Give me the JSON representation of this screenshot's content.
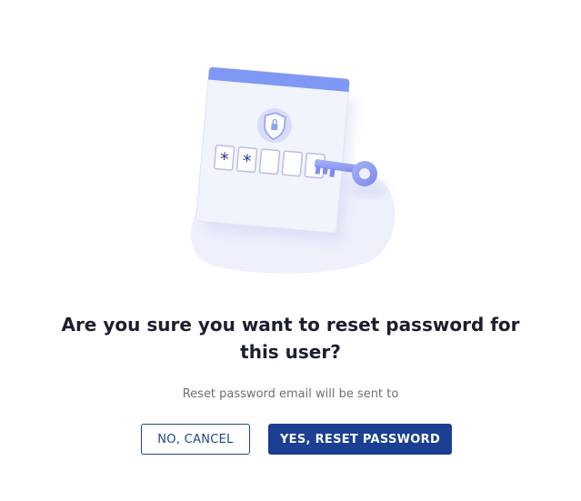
{
  "dialog": {
    "title": "Are you sure you want to reset password for this user?",
    "message": "Reset password email will be sent to",
    "cancel_label": "NO, CANCEL",
    "confirm_label": "YES, RESET PASSWORD"
  },
  "illustration": {
    "icons": [
      "shield-lock-icon",
      "key-icon"
    ],
    "password_slots": [
      "*",
      "*",
      "",
      "",
      ""
    ]
  },
  "colors": {
    "primary": "#1a3f93",
    "illustration_accent": "#7d95f5",
    "blob": "#eef0fb",
    "title_text": "#1c1f2e",
    "muted_text": "#6b6f7b"
  }
}
